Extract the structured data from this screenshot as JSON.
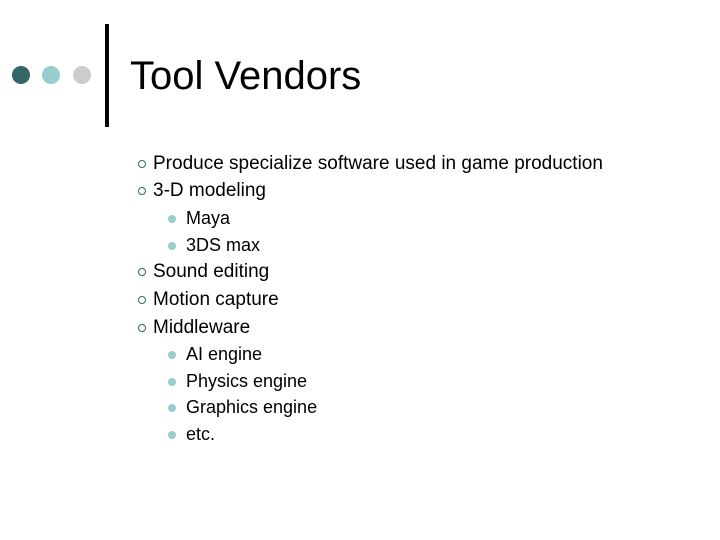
{
  "slide": {
    "title": "Tool Vendors",
    "decor": {
      "dots": [
        {
          "name": "dark-teal",
          "color": "#336666"
        },
        {
          "name": "light-teal",
          "color": "#99cccc"
        },
        {
          "name": "light-grey",
          "color": "#cccccc"
        }
      ],
      "bullet_l1_color": "#336666",
      "bullet_l2_color": "#99cccc"
    },
    "bullets": [
      {
        "level": 1,
        "text": "Produce specialize software used in game production"
      },
      {
        "level": 1,
        "text": "3-D modeling"
      },
      {
        "level": 2,
        "text": "Maya"
      },
      {
        "level": 2,
        "text": "3DS max"
      },
      {
        "level": 1,
        "text": "Sound editing"
      },
      {
        "level": 1,
        "text": "Motion capture"
      },
      {
        "level": 1,
        "text": "Middleware"
      },
      {
        "level": 2,
        "text": "AI engine"
      },
      {
        "level": 2,
        "text": "Physics engine"
      },
      {
        "level": 2,
        "text": "Graphics engine"
      },
      {
        "level": 2,
        "text": "etc."
      }
    ]
  }
}
